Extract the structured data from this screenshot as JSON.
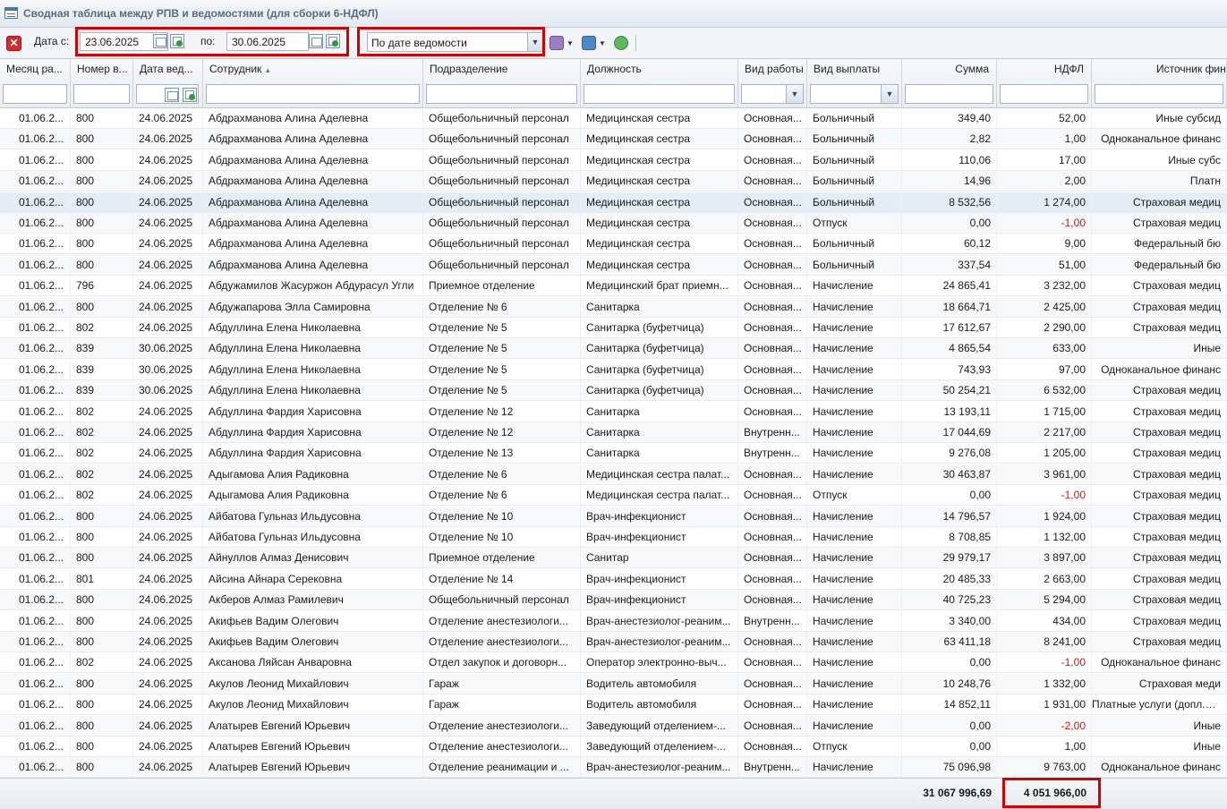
{
  "window": {
    "title": "Сводная таблица между РПВ и ведомостями (для сборки 6-НДФЛ)"
  },
  "toolbar": {
    "date_from_label": "Дата с:",
    "date_from_value": "23.06.2025",
    "date_to_label": "по:",
    "date_to_value": "30.06.2025",
    "mode_select_value": "По дате ведомости",
    "icons": [
      "close-icon",
      "calendar-icon",
      "clear-date-icon",
      "settings-icon",
      "print-icon",
      "refresh-icon"
    ]
  },
  "columns": [
    "Месяц ра...",
    "Номер в...",
    "Дата вед...",
    "Сотрудник",
    "Подразделение",
    "Должность",
    "Вид работы",
    "Вид выплаты",
    "Сумма",
    "НДФЛ",
    "Источник фин"
  ],
  "rows": [
    [
      "01.06.2...",
      "800",
      "24.06.2025",
      "Абдрахманова Алина Аделевна",
      "Общебольничный персонал",
      "Медицинская сестра",
      "Основная...",
      "Больничный",
      "349,40",
      "52,00",
      "Иные субсид"
    ],
    [
      "01.06.2...",
      "800",
      "24.06.2025",
      "Абдрахманова Алина Аделевна",
      "Общебольничный персонал",
      "Медицинская сестра",
      "Основная...",
      "Больничный",
      "2,82",
      "1,00",
      "Одноканальное финанс"
    ],
    [
      "01.06.2...",
      "800",
      "24.06.2025",
      "Абдрахманова Алина Аделевна",
      "Общебольничный персонал",
      "Медицинская сестра",
      "Основная...",
      "Больничный",
      "110,06",
      "17,00",
      "Иные субс"
    ],
    [
      "01.06.2...",
      "800",
      "24.06.2025",
      "Абдрахманова Алина Аделевна",
      "Общебольничный персонал",
      "Медицинская сестра",
      "Основная...",
      "Больничный",
      "14,96",
      "2,00",
      "Платн"
    ],
    [
      "01.06.2...",
      "800",
      "24.06.2025",
      "Абдрахманова Алина Аделевна",
      "Общебольничный персонал",
      "Медицинская сестра",
      "Основная...",
      "Больничный",
      "8 532,56",
      "1 274,00",
      "Страховая медиц"
    ],
    [
      "01.06.2...",
      "800",
      "24.06.2025",
      "Абдрахманова Алина Аделевна",
      "Общебольничный персонал",
      "Медицинская сестра",
      "Основная...",
      "Отпуск",
      "0,00",
      "-1,00",
      "Страховая медиц"
    ],
    [
      "01.06.2...",
      "800",
      "24.06.2025",
      "Абдрахманова Алина Аделевна",
      "Общебольничный персонал",
      "Медицинская сестра",
      "Основная...",
      "Больничный",
      "60,12",
      "9,00",
      "Федеральный бю"
    ],
    [
      "01.06.2...",
      "800",
      "24.06.2025",
      "Абдрахманова Алина Аделевна",
      "Общебольничный персонал",
      "Медицинская сестра",
      "Основная...",
      "Больничный",
      "337,54",
      "51,00",
      "Федеральный бю"
    ],
    [
      "01.06.2...",
      "796",
      "24.06.2025",
      "Абдужамилов Жасуржон Абдурасул Угли",
      "Приемное отделение",
      "Медицинский брат приемн...",
      "Основная...",
      "Начисление",
      "24 865,41",
      "3 232,00",
      "Страховая медиц"
    ],
    [
      "01.06.2...",
      "800",
      "24.06.2025",
      "Абдужапарова Элла Самировна",
      "Отделение № 6",
      "Санитарка",
      "Основная...",
      "Начисление",
      "18 664,71",
      "2 425,00",
      "Страховая медиц"
    ],
    [
      "01.06.2...",
      "802",
      "24.06.2025",
      "Абдуллина Елена Николаевна",
      "Отделение № 5",
      "Санитарка (буфетчица)",
      "Основная...",
      "Начисление",
      "17 612,67",
      "2 290,00",
      "Страховая медиц"
    ],
    [
      "01.06.2...",
      "839",
      "30.06.2025",
      "Абдуллина Елена Николаевна",
      "Отделение № 5",
      "Санитарка (буфетчица)",
      "Основная...",
      "Начисление",
      "4 865,54",
      "633,00",
      "Иные"
    ],
    [
      "01.06.2...",
      "839",
      "30.06.2025",
      "Абдуллина Елена Николаевна",
      "Отделение № 5",
      "Санитарка (буфетчица)",
      "Основная...",
      "Начисление",
      "743,93",
      "97,00",
      "Одноканальное финанс"
    ],
    [
      "01.06.2...",
      "839",
      "30.06.2025",
      "Абдуллина Елена Николаевна",
      "Отделение № 5",
      "Санитарка (буфетчица)",
      "Основная...",
      "Начисление",
      "50 254,21",
      "6 532,00",
      "Страховая медиц"
    ],
    [
      "01.06.2...",
      "802",
      "24.06.2025",
      "Абдуллина Фардия Харисовна",
      "Отделение № 12",
      "Санитарка",
      "Основная...",
      "Начисление",
      "13 193,11",
      "1 715,00",
      "Страховая медиц"
    ],
    [
      "01.06.2...",
      "802",
      "24.06.2025",
      "Абдуллина Фардия Харисовна",
      "Отделение № 12",
      "Санитарка",
      "Внутренн...",
      "Начисление",
      "17 044,69",
      "2 217,00",
      "Страховая медиц"
    ],
    [
      "01.06.2...",
      "802",
      "24.06.2025",
      "Абдуллина Фардия Харисовна",
      "Отделение № 13",
      "Санитарка",
      "Внутренн...",
      "Начисление",
      "9 276,08",
      "1 205,00",
      "Страховая медиц"
    ],
    [
      "01.06.2...",
      "802",
      "24.06.2025",
      "Адыгамова Алия Радиковна",
      "Отделение № 6",
      "Медицинская сестра палат...",
      "Основная...",
      "Начисление",
      "30 463,87",
      "3 961,00",
      "Страховая медиц"
    ],
    [
      "01.06.2...",
      "802",
      "24.06.2025",
      "Адыгамова Алия Радиковна",
      "Отделение № 6",
      "Медицинская сестра палат...",
      "Основная...",
      "Отпуск",
      "0,00",
      "-1,00",
      "Страховая медиц"
    ],
    [
      "01.06.2...",
      "800",
      "24.06.2025",
      "Айбатова Гульназ Ильдусовна",
      "Отделение № 10",
      "Врач-инфекционист",
      "Основная...",
      "Начисление",
      "14 796,57",
      "1 924,00",
      "Страховая медиц"
    ],
    [
      "01.06.2...",
      "800",
      "24.06.2025",
      "Айбатова Гульназ Ильдусовна",
      "Отделение № 10",
      "Врач-инфекционист",
      "Основная...",
      "Начисление",
      "8 708,85",
      "1 132,00",
      "Страховая медиц"
    ],
    [
      "01.06.2...",
      "800",
      "24.06.2025",
      "Айнуллов Алмаз Денисович",
      "Приемное отделение",
      "Санитар",
      "Основная...",
      "Начисление",
      "29 979,17",
      "3 897,00",
      "Страховая медиц"
    ],
    [
      "01.06.2...",
      "801",
      "24.06.2025",
      "Айсина Айнара Серековна",
      "Отделение № 14",
      "Врач-инфекционист",
      "Основная...",
      "Начисление",
      "20 485,33",
      "2 663,00",
      "Страховая медиц"
    ],
    [
      "01.06.2...",
      "800",
      "24.06.2025",
      "Акберов Алмаз Рамилевич",
      "Общебольничный персонал",
      "Врач-инфекционист",
      "Основная...",
      "Начисление",
      "40 725,23",
      "5 294,00",
      "Страховая медиц"
    ],
    [
      "01.06.2...",
      "800",
      "24.06.2025",
      "Акифьев Вадим Олегович",
      "Отделение анестезиологи...",
      "Врач-анестезиолог-реаним...",
      "Внутренн...",
      "Начисление",
      "3 340,00",
      "434,00",
      "Страховая медиц"
    ],
    [
      "01.06.2...",
      "800",
      "24.06.2025",
      "Акифьев Вадим Олегович",
      "Отделение анестезиологи...",
      "Врач-анестезиолог-реаним...",
      "Основная...",
      "Начисление",
      "63 411,18",
      "8 241,00",
      "Страховая медиц"
    ],
    [
      "01.06.2...",
      "802",
      "24.06.2025",
      "Аксанова Ляйсан Анваровна",
      "Отдел закупок и договорн...",
      "Оператор электронно-выч...",
      "Основная...",
      "Начисление",
      "0,00",
      "-1,00",
      "Одноканальное финанс"
    ],
    [
      "01.06.2...",
      "800",
      "24.06.2025",
      "Акулов Леонид Михайлович",
      "Гараж",
      "Водитель автомобиля",
      "Основная...",
      "Начисление",
      "10 248,76",
      "1 332,00",
      "Страховая меди"
    ],
    [
      "01.06.2...",
      "800",
      "24.06.2025",
      "Акулов Леонид Михайлович",
      "Гараж",
      "Водитель автомобиля",
      "Основная...",
      "Начисление",
      "14 852,11",
      "1 931,00",
      "Платные услуги (допл.вод"
    ],
    [
      "01.06.2...",
      "800",
      "24.06.2025",
      "Алатырев Евгений Юрьевич",
      "Отделение анестезиологи...",
      "Заведующий отделением-...",
      "Основная...",
      "Начисление",
      "0,00",
      "-2,00",
      "Иные"
    ],
    [
      "01.06.2...",
      "800",
      "24.06.2025",
      "Алатырев Евгений Юрьевич",
      "Отделение анестезиологи...",
      "Заведующий отделением-...",
      "Основная...",
      "Отпуск",
      "0,00",
      "1,00",
      "Иные"
    ],
    [
      "01.06.2...",
      "800",
      "24.06.2025",
      "Алатырев Евгений Юрьевич",
      "Отделение реанимации и ...",
      "Врач-анестезиолог-реаним...",
      "Внутренн...",
      "Начисление",
      "75 096,98",
      "9 763,00",
      "Одноканальное финанс"
    ]
  ],
  "totals": {
    "sum": "31 067 996,69",
    "ndfl": "4 051 966,00"
  },
  "colors": {
    "highlight_border": "#d40000",
    "negative_value": "#c41a1a",
    "selected_row": "#e4ecf6"
  }
}
